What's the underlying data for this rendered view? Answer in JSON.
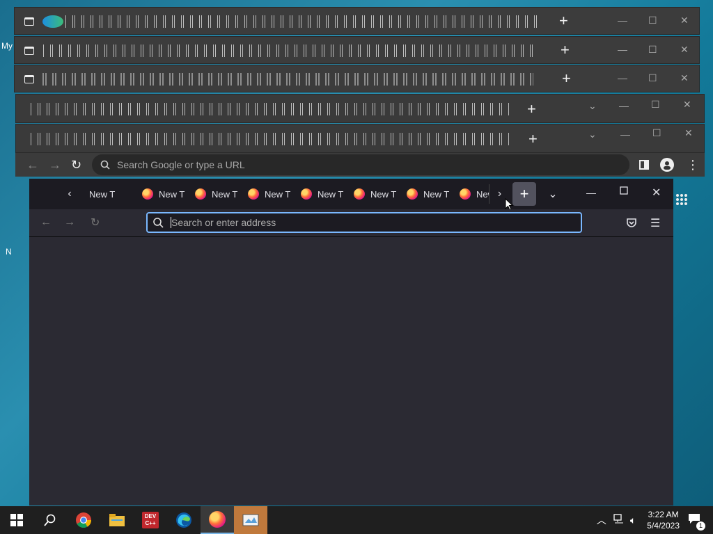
{
  "desktop": {
    "label_my": "My",
    "label_n": "N"
  },
  "chrome": {
    "omnibox_placeholder": "Search Google or type a URL"
  },
  "firefox": {
    "tabs": [
      {
        "label": "New T"
      },
      {
        "label": "New T"
      },
      {
        "label": "New T"
      },
      {
        "label": "New T"
      },
      {
        "label": "New T"
      },
      {
        "label": "New T"
      },
      {
        "label": "New T"
      },
      {
        "label": "New"
      }
    ],
    "url_placeholder": "Search or enter address"
  },
  "taskbar": {
    "time": "3:22 AM",
    "date": "5/4/2023",
    "devcpp_label_1": "DEV",
    "devcpp_label_2": "C++",
    "notification_count": "1"
  },
  "colors": {
    "accent_focus": "#7ab8ff",
    "taskbar_bg": "#1f1f1f",
    "ff_toolbar": "#2b2a33"
  }
}
